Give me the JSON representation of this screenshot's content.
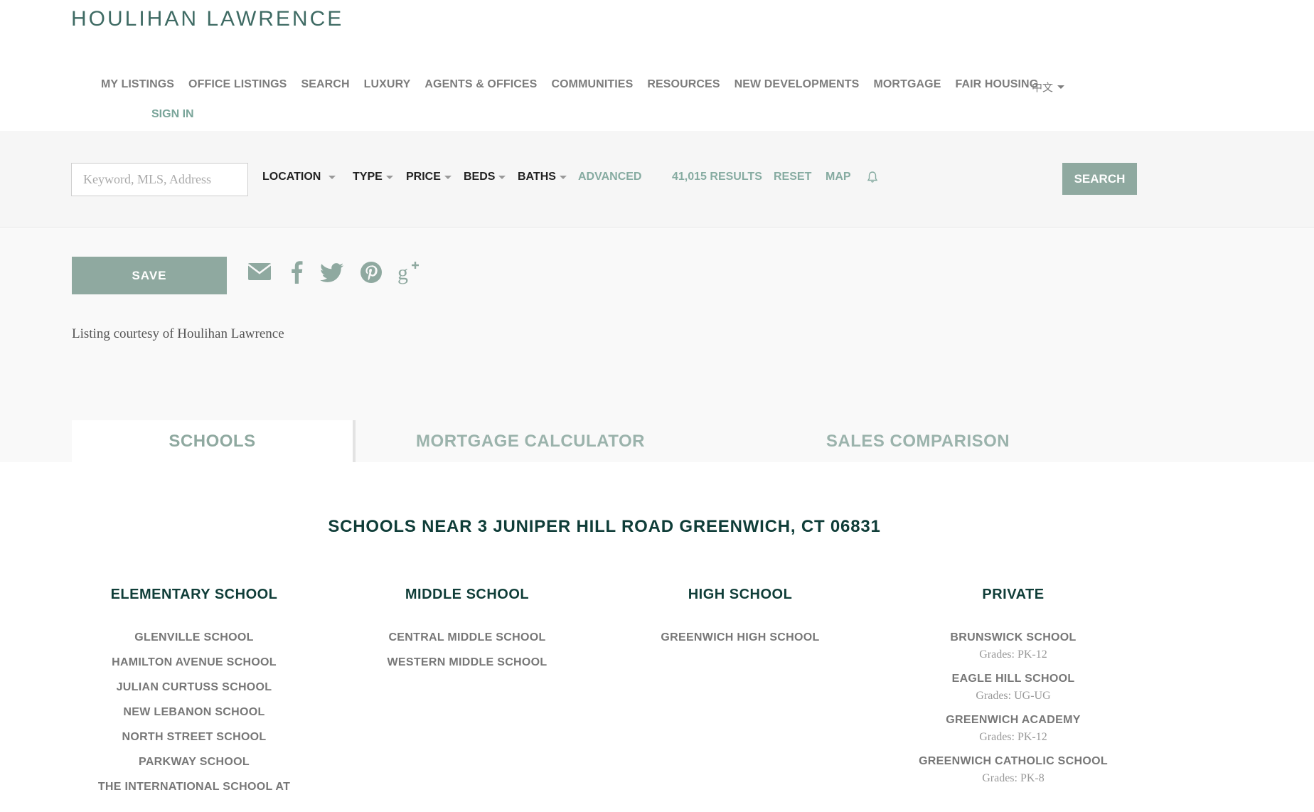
{
  "brand": {
    "logo_text": "HOULIHAN LAWRENCE",
    "accent": "#8fa9a0",
    "dark_teal": "#0f3d38"
  },
  "nav": {
    "items": [
      "MY LISTINGS",
      "OFFICE LISTINGS",
      "SEARCH",
      "LUXURY",
      "AGENTS & OFFICES",
      "COMMUNITIES",
      "RESOURCES",
      "NEW DEVELOPMENTS",
      "MORTGAGE",
      "FAIR HOUSING"
    ],
    "language": "中文",
    "sign_in": "SIGN IN"
  },
  "search": {
    "placeholder": "Keyword, MLS, Address",
    "filters": {
      "location": "LOCATION",
      "type": "TYPE",
      "price": "PRICE",
      "beds": "BEDS",
      "baths": "BATHS"
    },
    "advanced": "ADVANCED",
    "results": "41,015 RESULTS",
    "reset": "RESET",
    "map": "MAP",
    "alert_icon": "bell-icon",
    "button": "SEARCH"
  },
  "listing": {
    "save": "SAVE",
    "share_icons": [
      "envelope-icon",
      "facebook-icon",
      "twitter-icon",
      "pinterest-icon",
      "google-plus-icon"
    ],
    "courtesy": "Listing courtesy of Houlihan Lawrence"
  },
  "tabs": [
    {
      "label": "SCHOOLS",
      "active": true
    },
    {
      "label": "MORTGAGE CALCULATOR",
      "active": false
    },
    {
      "label": "SALES COMPARISON",
      "active": false
    }
  ],
  "schools": {
    "title": "SCHOOLS NEAR 3 JUNIPER HILL ROAD GREENWICH, CT 06831",
    "elementary": {
      "heading": "ELEMENTARY SCHOOL",
      "items": [
        "GLENVILLE SCHOOL",
        "HAMILTON AVENUE SCHOOL",
        "JULIAN CURTUSS SCHOOL",
        "NEW LEBANON SCHOOL",
        "NORTH STREET SCHOOL",
        "PARKWAY SCHOOL",
        "THE INTERNATIONAL SCHOOL AT"
      ]
    },
    "middle": {
      "heading": "MIDDLE SCHOOL",
      "items": [
        "CENTRAL MIDDLE SCHOOL",
        "WESTERN MIDDLE SCHOOL"
      ]
    },
    "high": {
      "heading": "HIGH SCHOOL",
      "items": [
        "GREENWICH HIGH SCHOOL"
      ]
    },
    "private": {
      "heading": "PRIVATE",
      "items": [
        {
          "name": "BRUNSWICK SCHOOL",
          "grades": "Grades: PK-12"
        },
        {
          "name": "EAGLE HILL SCHOOL",
          "grades": "Grades: UG-UG"
        },
        {
          "name": "GREENWICH ACADEMY",
          "grades": "Grades: PK-12"
        },
        {
          "name": "GREENWICH CATHOLIC SCHOOL",
          "grades": "Grades: PK-8"
        }
      ]
    }
  }
}
